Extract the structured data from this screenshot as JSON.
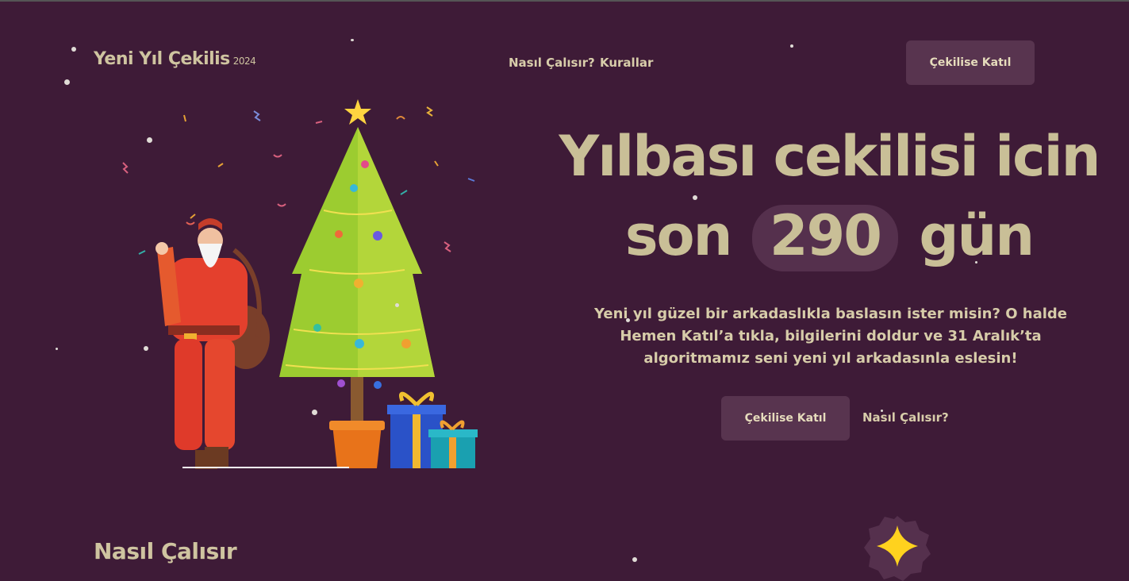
{
  "header": {
    "logo_title": "Yeni Yıl Çekilis",
    "logo_year": "2024",
    "nav": [
      "Nasıl Çalısır?",
      "Kurallar"
    ],
    "cta_label": "Çekilise Katıl"
  },
  "hero": {
    "title_line1": "Yılbası cekilisi icin",
    "title_prefix": "son",
    "days_count": "290",
    "title_suffix": "gün",
    "description": "Yeni yıl güzel bir arkadaslıkla baslasın ister misin? O halde Hemen Katıl’a tıkla, bilgilerini doldur ve 31 Aralık’ta algoritmamız seni yeni yıl arkadasınla eslesin!",
    "primary_button": "Çekilise Katıl",
    "secondary_link": "Nasıl Çalısır?"
  },
  "section": {
    "title": "Nasıl Çalısır"
  },
  "illustration_icons": [
    "santa-icon",
    "christmas-tree-icon",
    "gift-box-icon",
    "star-badge-icon"
  ],
  "colors": {
    "background": "#3e1b37",
    "text": "#d4c9a6",
    "button": "#58344f",
    "accent_star": "#ffd21e"
  }
}
